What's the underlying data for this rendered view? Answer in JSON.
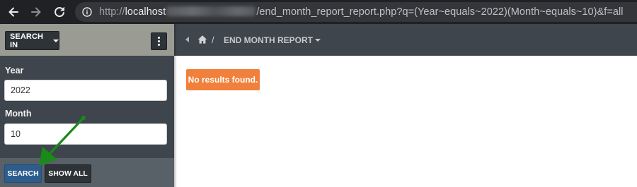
{
  "browser": {
    "url_prefix": "http://",
    "url_host": "localhost",
    "url_path": "/end_month_report_report.php?q=(Year~equals~2022)(Month~equals~10)&f=all",
    "icons": [
      "back-arrow-icon",
      "forward-arrow-icon",
      "reload-icon",
      "info-icon"
    ]
  },
  "sidebar": {
    "search_in_label": "SEARCH IN",
    "fields": [
      {
        "label": "Year",
        "value": "2022"
      },
      {
        "label": "Month",
        "value": "10"
      }
    ],
    "search_button": "SEARCH",
    "show_all_button": "SHOW ALL"
  },
  "header": {
    "breadcrumb_separator": "/",
    "title": "END MONTH REPORT"
  },
  "main": {
    "alert_text": "No results found."
  },
  "colors": {
    "sidebar": "#3e454c",
    "search_in_bar": "#9a9c94",
    "search_button": "#2d5d8c",
    "alert": "#f0803c",
    "annotation_arrow": "#1a8a1a"
  }
}
